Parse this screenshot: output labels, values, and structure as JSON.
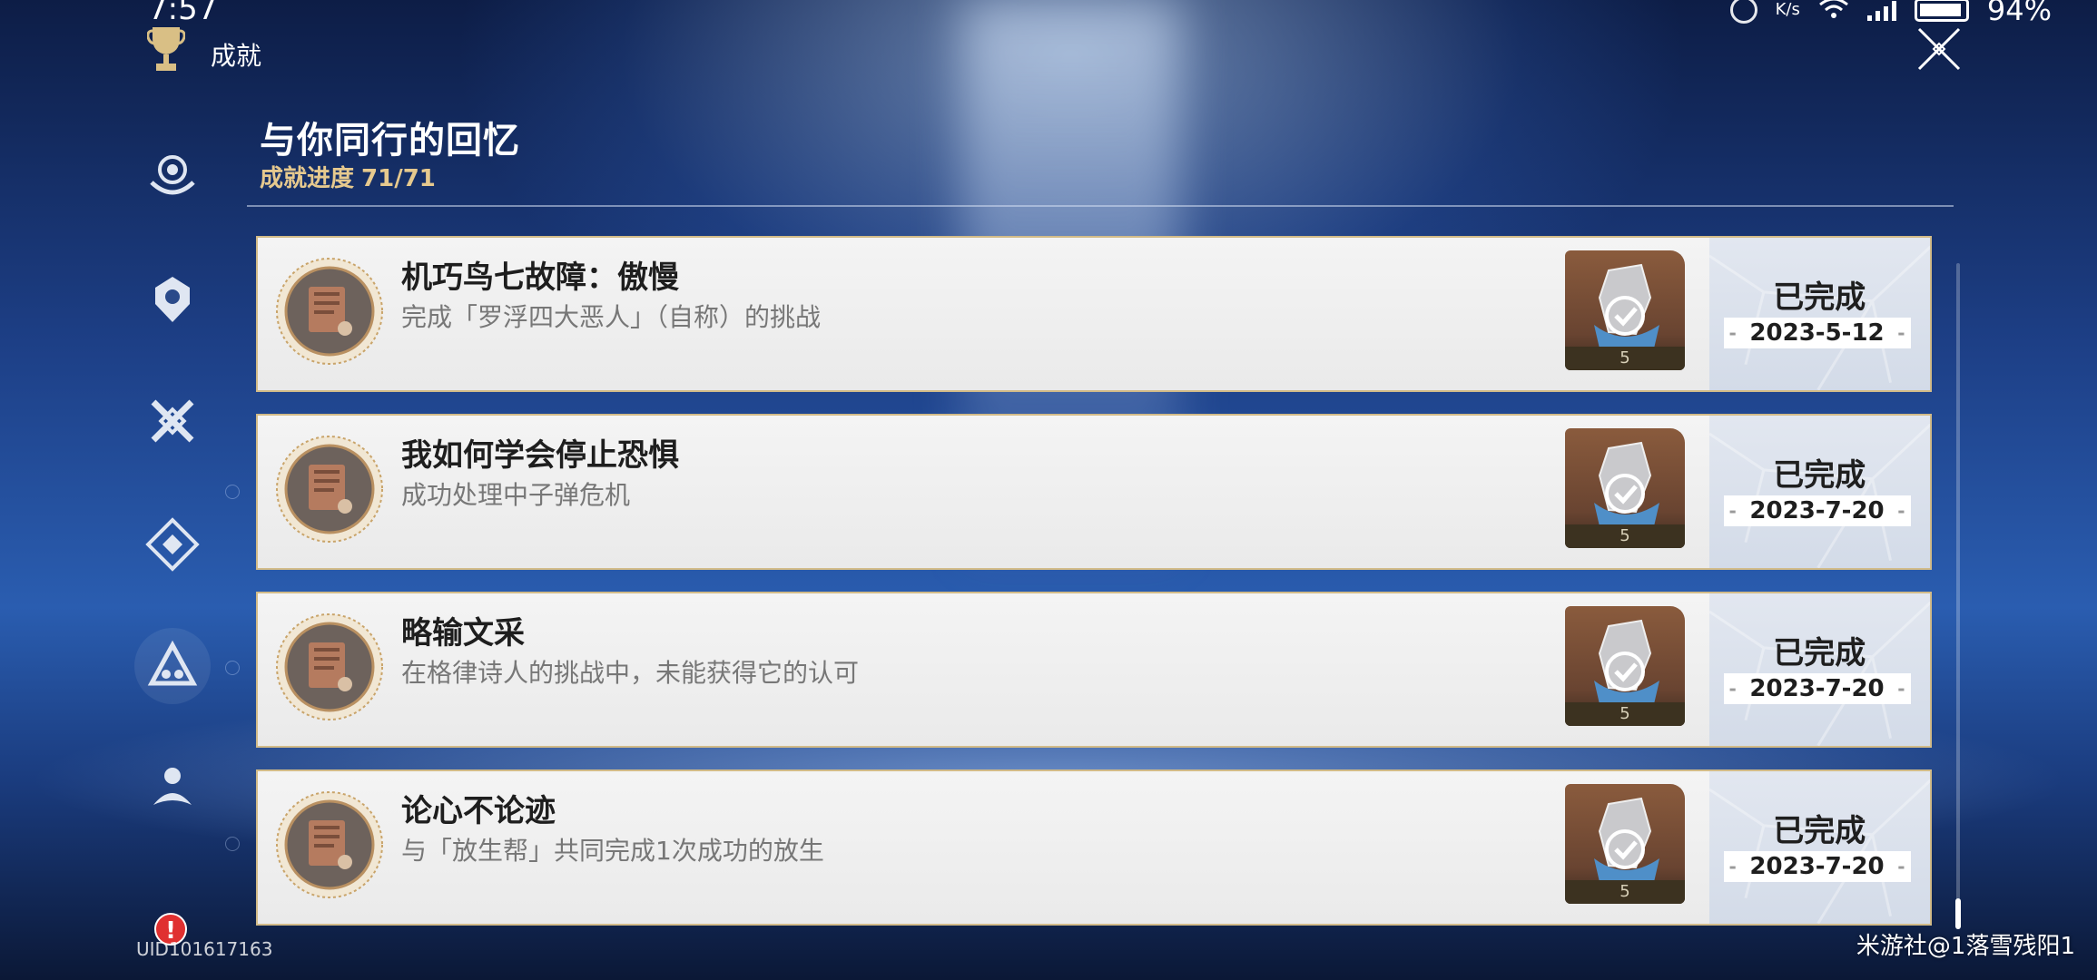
{
  "status_bar": {
    "time": "7:57",
    "net_speed_unit": "K/s",
    "battery": "94%"
  },
  "header": {
    "label": "成就",
    "trophy_icon": "trophy-icon",
    "close_icon": "close-icon"
  },
  "sidebar": {
    "items": [
      {
        "icon": "category-icon-1",
        "active": false
      },
      {
        "icon": "category-icon-2",
        "active": false
      },
      {
        "icon": "category-icon-3",
        "active": false
      },
      {
        "icon": "category-icon-4",
        "active": false
      },
      {
        "icon": "category-icon-5",
        "active": true
      },
      {
        "icon": "category-icon-6",
        "active": false
      }
    ]
  },
  "group": {
    "title": "与你同行的回忆",
    "progress_label": "成就进度",
    "progress_value": "71/71"
  },
  "achievements": [
    {
      "title": "机巧鸟七故障：傲慢",
      "desc": "完成「罗浮四大恶人」（自称）的挑战",
      "reward_count": "5",
      "status": "已完成",
      "date": "2023-5-12"
    },
    {
      "title": "我如何学会停止恐惧",
      "desc": "成功处理中子弹危机",
      "reward_count": "5",
      "status": "已完成",
      "date": "2023-7-20"
    },
    {
      "title": "略输文采",
      "desc": "在格律诗人的挑战中，未能获得它的认可",
      "reward_count": "5",
      "status": "已完成",
      "date": "2023-7-20"
    },
    {
      "title": "论心不论迹",
      "desc": "与「放生帮」共同完成1次成功的放生",
      "reward_count": "5",
      "status": "已完成",
      "date": "2023-7-20"
    }
  ],
  "footer": {
    "alert": "!",
    "uid": "UID101617163",
    "watermark": "米游社@1落雪残阳1"
  },
  "colors": {
    "accent_gold": "#e6c98e",
    "row_border": "#d2bb88",
    "alert_red": "#e03030"
  }
}
